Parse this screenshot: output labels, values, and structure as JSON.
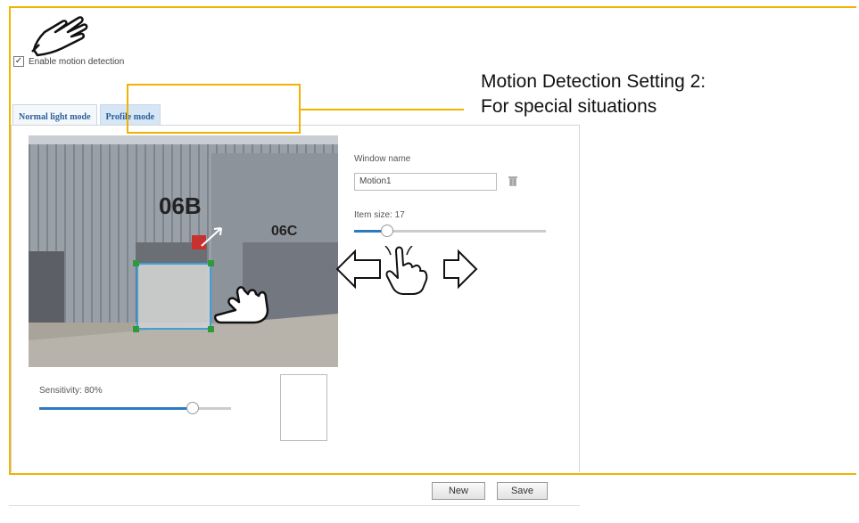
{
  "enable": {
    "label": "Enable motion detection",
    "checked": true
  },
  "tabs": [
    {
      "label": "Normal light mode",
      "active": false
    },
    {
      "label": "Profile mode",
      "active": true
    }
  ],
  "callout": {
    "line1": "Motion Detection Setting 2:",
    "line2": "For special situations"
  },
  "snapshot": {
    "sign_main": "06B",
    "sign_side": "06C"
  },
  "window_name": {
    "label": "Window name",
    "value": "Motion1"
  },
  "item_size": {
    "label": "Item size: 17",
    "level": 0.17
  },
  "sensitivity": {
    "label": "Sensitivity: 80%",
    "level": 0.8
  },
  "buttons": {
    "new": "New",
    "save": "Save"
  },
  "colors": {
    "highlight": "#f2b200",
    "slider_fill": "#2c7ac3",
    "tab_text": "#2a5f9a",
    "window_border": "#3fa0d8",
    "window_handle": "#2e9a3a"
  }
}
